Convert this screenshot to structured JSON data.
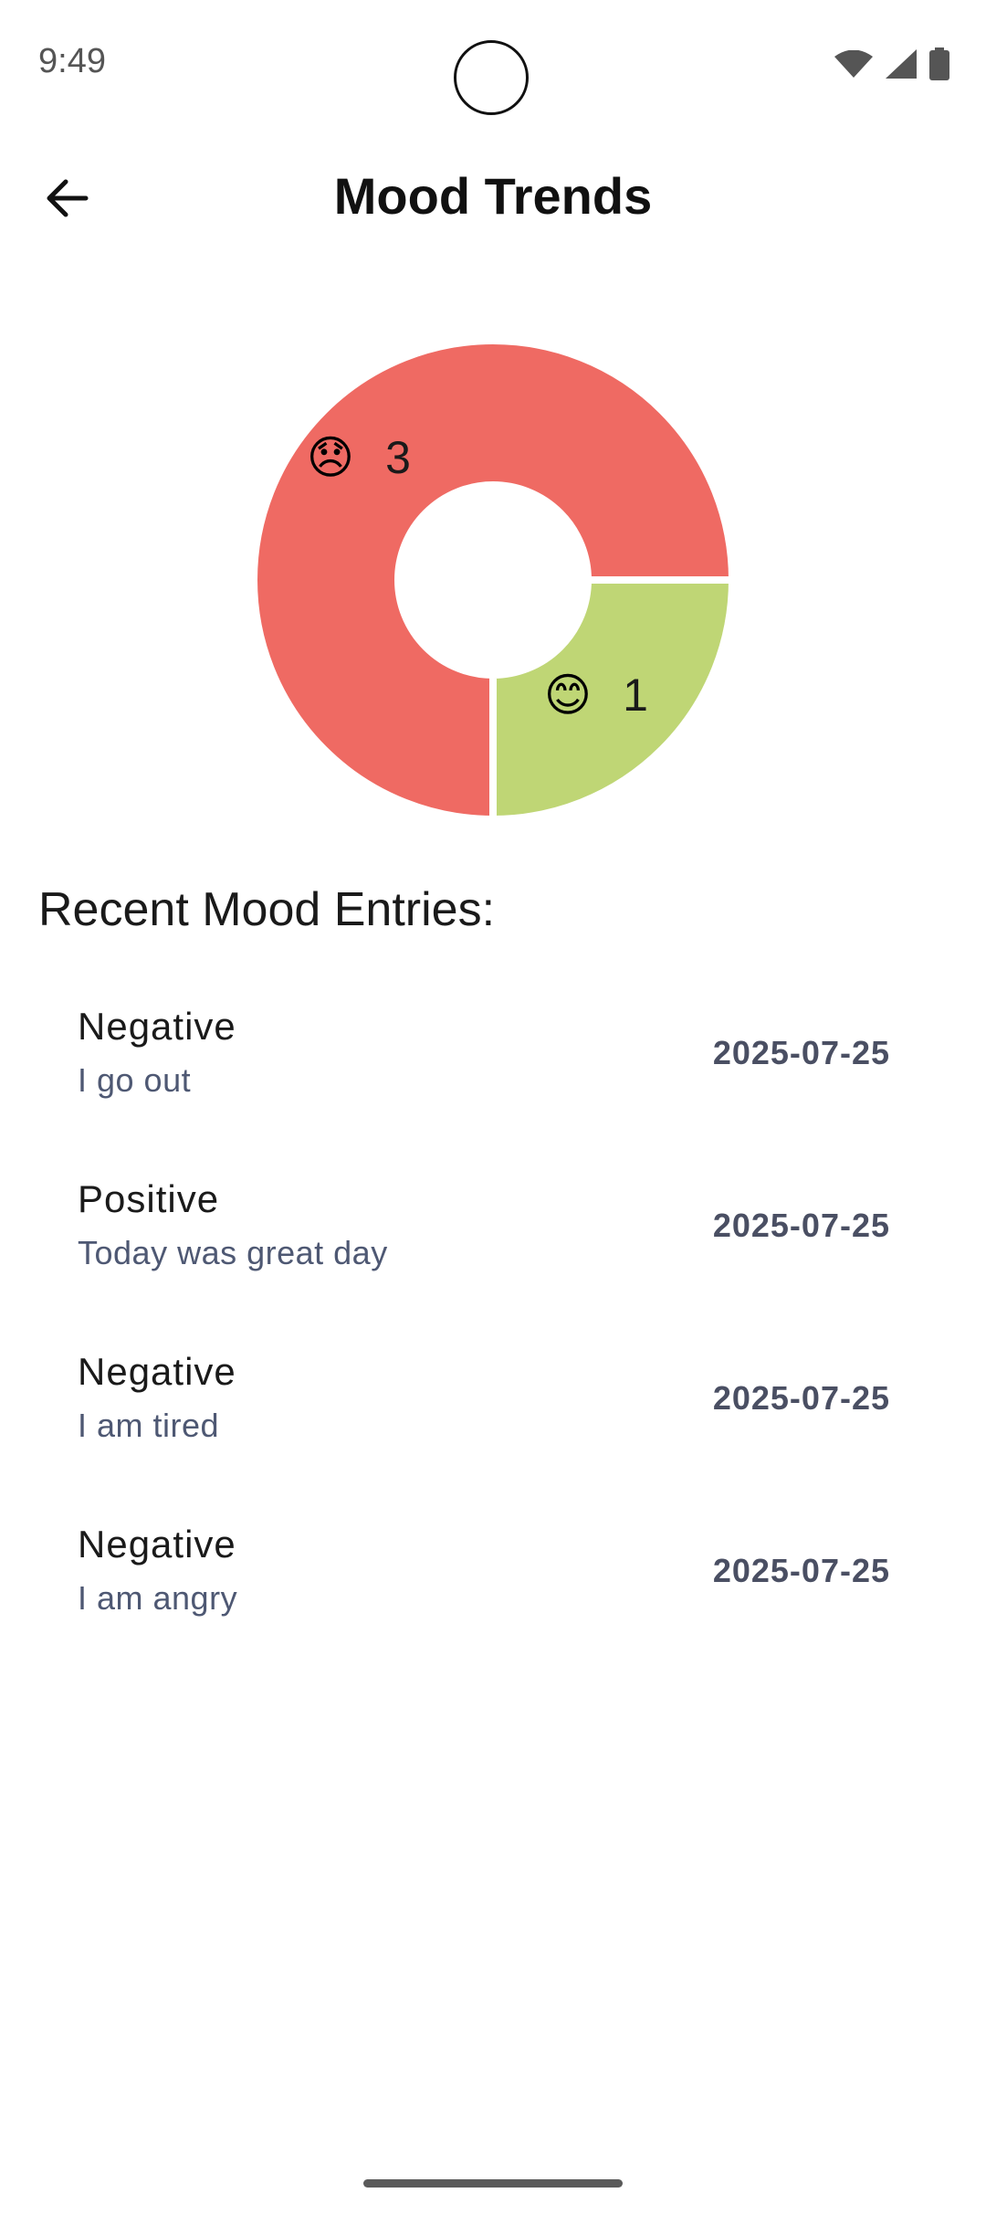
{
  "status": {
    "time": "9:49",
    "icons": [
      "wifi-icon",
      "cell-signal-icon",
      "battery-icon"
    ]
  },
  "header": {
    "title": "Mood Trends",
    "back_icon": "arrow-left-icon"
  },
  "chart_data": {
    "type": "pie",
    "donut": true,
    "slices": [
      {
        "emoji": "😞",
        "value": 3,
        "count_label": "3",
        "color": "#ef6a63"
      },
      {
        "emoji": "😊",
        "value": 1,
        "count_label": "1",
        "color": "#bfd675"
      }
    ]
  },
  "recent": {
    "title": "Recent Mood Entries:",
    "entries": [
      {
        "mood": "Negative",
        "note": "I go out",
        "date": "2025-07-25"
      },
      {
        "mood": "Positive",
        "note": "Today was great day",
        "date": "2025-07-25"
      },
      {
        "mood": "Negative",
        "note": "I am tired",
        "date": "2025-07-25"
      },
      {
        "mood": "Negative",
        "note": "I am angry",
        "date": "2025-07-25"
      }
    ]
  },
  "colors": {
    "negative": "#ef6a63",
    "positive": "#bfd675",
    "note_text": "#4e5873",
    "date_text": "#4a4f63"
  }
}
